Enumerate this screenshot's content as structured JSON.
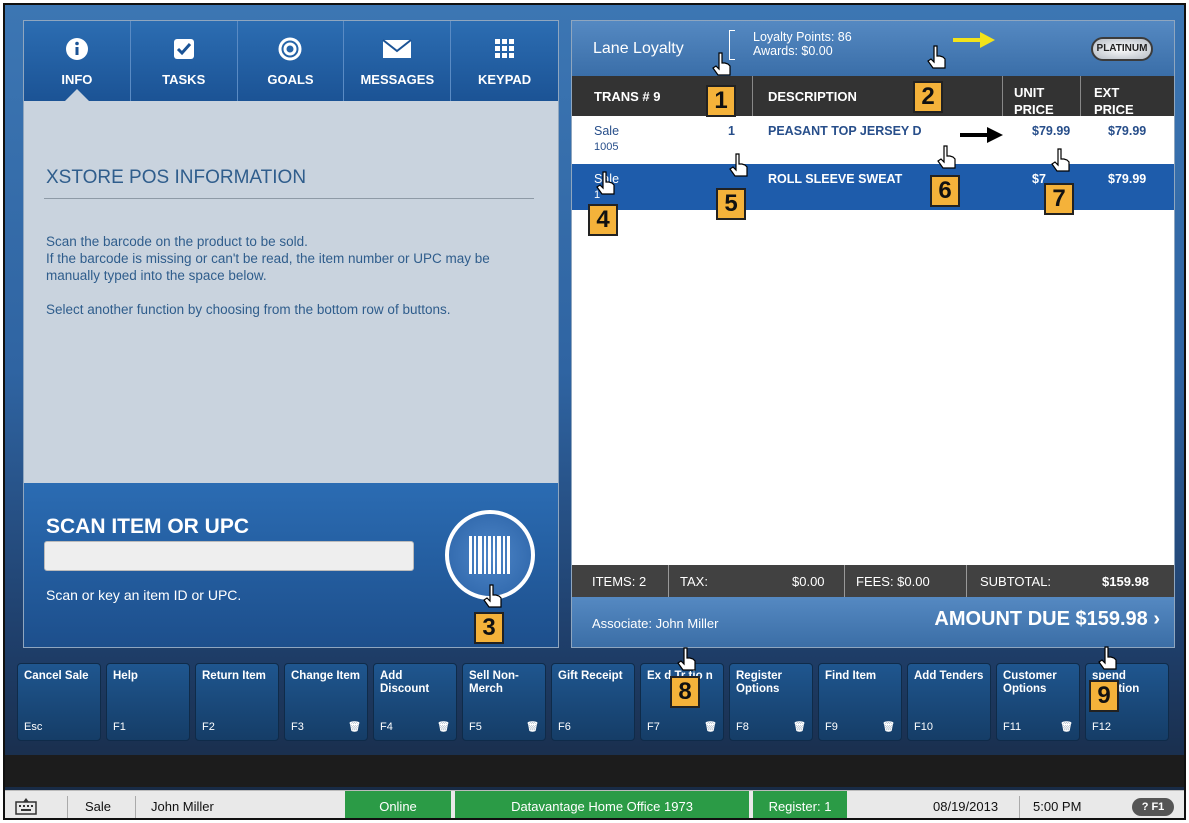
{
  "tabs": [
    {
      "label": "INFO",
      "icon": "info-icon"
    },
    {
      "label": "TASKS",
      "icon": "checkbox-icon"
    },
    {
      "label": "GOALS",
      "icon": "target-icon"
    },
    {
      "label": "MESSAGES",
      "icon": "envelope-icon"
    },
    {
      "label": "KEYPAD",
      "icon": "keypad-icon"
    }
  ],
  "info": {
    "title": "XSTORE POS INFORMATION",
    "line1": "Scan the barcode on the product to be sold.",
    "line2": "If the barcode is missing or can't be read, the item number or UPC may be manually typed into the space below.",
    "line3": "Select another function by choosing from the bottom row of buttons."
  },
  "scan": {
    "title": "SCAN ITEM OR UPC",
    "value": "",
    "hint": "Scan or key an item ID or UPC."
  },
  "loyalty": {
    "name": "Lane Loyalty",
    "points": "Loyalty Points: 86",
    "awards": "Awards: $0.00",
    "badge": "PLATINUM"
  },
  "transaction": {
    "headers": {
      "trans": "TRANS # 9",
      "description": "DESCRIPTION",
      "unit": "UNIT PRICE",
      "ext": "EXT PRICE"
    },
    "rows": [
      {
        "type": "Sale",
        "sku": "1005",
        "qty": "1",
        "description": "PEASANT TOP JERSEY D",
        "unit": "$79.99",
        "ext": "$79.99"
      },
      {
        "type": "Sale",
        "sku": "1",
        "qty": "",
        "description": "ROLL SLEEVE SWEAT",
        "unit": "$7",
        "ext": "$79.99"
      }
    ]
  },
  "totals": {
    "items": "ITEMS: 2",
    "tax_label": "TAX:",
    "tax": "$0.00",
    "fees": "FEES: $0.00",
    "subtotal_label": "SUBTOTAL:",
    "subtotal": "$159.98"
  },
  "due": {
    "associate": "Associate: John Miller",
    "amount": "AMOUNT DUE $159.98 ›"
  },
  "fkeys": [
    {
      "label": "Cancel Sale",
      "code": "Esc",
      "del": false
    },
    {
      "label": "Help",
      "code": "F1",
      "del": false
    },
    {
      "label": "Return Item",
      "code": "F2",
      "del": false
    },
    {
      "label": "Change Item",
      "code": "F3",
      "del": true
    },
    {
      "label": "Add Discount",
      "code": "F4",
      "del": true
    },
    {
      "label": "Sell Non-Merch",
      "code": "F5",
      "del": true
    },
    {
      "label": "Gift Receipt",
      "code": "F6",
      "del": false
    },
    {
      "label": "Ex      d Tr   tio n",
      "code": "F7",
      "del": true
    },
    {
      "label": "Register Options",
      "code": "F8",
      "del": true
    },
    {
      "label": "Find Item",
      "code": "F9",
      "del": true
    },
    {
      "label": "Add Tenders",
      "code": "F10",
      "del": false
    },
    {
      "label": "Customer Options",
      "code": "F11",
      "del": true
    },
    {
      "label": "   spend   nsaction",
      "code": "F12",
      "del": false
    }
  ],
  "status": {
    "mode": "Sale",
    "user": "John Miller",
    "online": "Online",
    "store": "Datavantage Home Office 1973",
    "register": "Register: 1",
    "date": "08/19/2013",
    "time": "5:00 PM",
    "help": "? F1"
  },
  "callouts": [
    "1",
    "2",
    "3",
    "4",
    "5",
    "6",
    "7",
    "8",
    "9"
  ],
  "colors": {
    "accent": "#1e5cab",
    "callout": "#f4b23a",
    "online": "#2b9b46"
  }
}
